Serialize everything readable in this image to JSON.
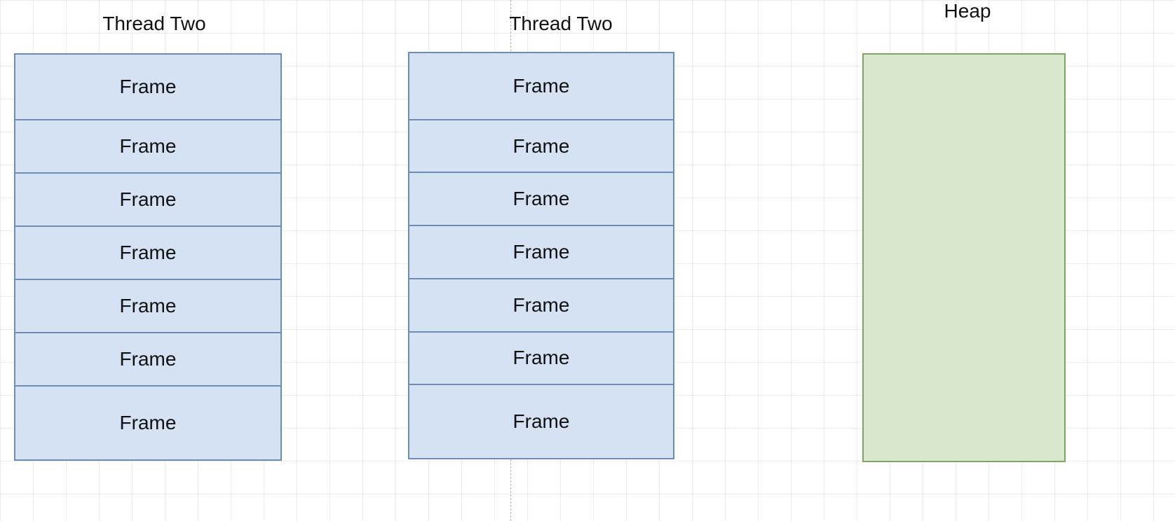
{
  "labels": {
    "thread1": "Thread Two",
    "thread2": "Thread Two",
    "heap": "Heap"
  },
  "stack1": {
    "frames": [
      "Frame",
      "Frame",
      "Frame",
      "Frame",
      "Frame",
      "Frame",
      "Frame"
    ]
  },
  "stack2": {
    "frames": [
      "Frame",
      "Frame",
      "Frame",
      "Frame",
      "Frame",
      "Frame",
      "Frame"
    ]
  },
  "colors": {
    "frame_fill": "#d4e2f4",
    "frame_border": "#6d8db7",
    "heap_fill": "#d8e9ce",
    "heap_border": "#7fa464",
    "grid": "rgba(200,200,200,0.35)"
  }
}
